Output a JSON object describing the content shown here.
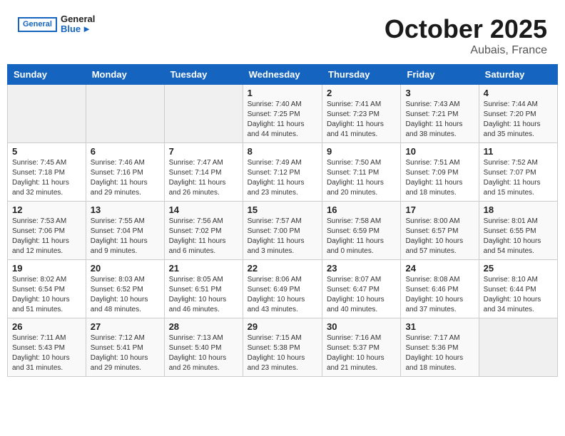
{
  "header": {
    "logo_general": "General",
    "logo_blue": "Blue",
    "month_title": "October 2025",
    "location": "Aubais, France"
  },
  "days_of_week": [
    "Sunday",
    "Monday",
    "Tuesday",
    "Wednesday",
    "Thursday",
    "Friday",
    "Saturday"
  ],
  "weeks": [
    [
      {
        "day": "",
        "info": ""
      },
      {
        "day": "",
        "info": ""
      },
      {
        "day": "",
        "info": ""
      },
      {
        "day": "1",
        "info": "Sunrise: 7:40 AM\nSunset: 7:25 PM\nDaylight: 11 hours and 44 minutes."
      },
      {
        "day": "2",
        "info": "Sunrise: 7:41 AM\nSunset: 7:23 PM\nDaylight: 11 hours and 41 minutes."
      },
      {
        "day": "3",
        "info": "Sunrise: 7:43 AM\nSunset: 7:21 PM\nDaylight: 11 hours and 38 minutes."
      },
      {
        "day": "4",
        "info": "Sunrise: 7:44 AM\nSunset: 7:20 PM\nDaylight: 11 hours and 35 minutes."
      }
    ],
    [
      {
        "day": "5",
        "info": "Sunrise: 7:45 AM\nSunset: 7:18 PM\nDaylight: 11 hours and 32 minutes."
      },
      {
        "day": "6",
        "info": "Sunrise: 7:46 AM\nSunset: 7:16 PM\nDaylight: 11 hours and 29 minutes."
      },
      {
        "day": "7",
        "info": "Sunrise: 7:47 AM\nSunset: 7:14 PM\nDaylight: 11 hours and 26 minutes."
      },
      {
        "day": "8",
        "info": "Sunrise: 7:49 AM\nSunset: 7:12 PM\nDaylight: 11 hours and 23 minutes."
      },
      {
        "day": "9",
        "info": "Sunrise: 7:50 AM\nSunset: 7:11 PM\nDaylight: 11 hours and 20 minutes."
      },
      {
        "day": "10",
        "info": "Sunrise: 7:51 AM\nSunset: 7:09 PM\nDaylight: 11 hours and 18 minutes."
      },
      {
        "day": "11",
        "info": "Sunrise: 7:52 AM\nSunset: 7:07 PM\nDaylight: 11 hours and 15 minutes."
      }
    ],
    [
      {
        "day": "12",
        "info": "Sunrise: 7:53 AM\nSunset: 7:06 PM\nDaylight: 11 hours and 12 minutes."
      },
      {
        "day": "13",
        "info": "Sunrise: 7:55 AM\nSunset: 7:04 PM\nDaylight: 11 hours and 9 minutes."
      },
      {
        "day": "14",
        "info": "Sunrise: 7:56 AM\nSunset: 7:02 PM\nDaylight: 11 hours and 6 minutes."
      },
      {
        "day": "15",
        "info": "Sunrise: 7:57 AM\nSunset: 7:00 PM\nDaylight: 11 hours and 3 minutes."
      },
      {
        "day": "16",
        "info": "Sunrise: 7:58 AM\nSunset: 6:59 PM\nDaylight: 11 hours and 0 minutes."
      },
      {
        "day": "17",
        "info": "Sunrise: 8:00 AM\nSunset: 6:57 PM\nDaylight: 10 hours and 57 minutes."
      },
      {
        "day": "18",
        "info": "Sunrise: 8:01 AM\nSunset: 6:55 PM\nDaylight: 10 hours and 54 minutes."
      }
    ],
    [
      {
        "day": "19",
        "info": "Sunrise: 8:02 AM\nSunset: 6:54 PM\nDaylight: 10 hours and 51 minutes."
      },
      {
        "day": "20",
        "info": "Sunrise: 8:03 AM\nSunset: 6:52 PM\nDaylight: 10 hours and 48 minutes."
      },
      {
        "day": "21",
        "info": "Sunrise: 8:05 AM\nSunset: 6:51 PM\nDaylight: 10 hours and 46 minutes."
      },
      {
        "day": "22",
        "info": "Sunrise: 8:06 AM\nSunset: 6:49 PM\nDaylight: 10 hours and 43 minutes."
      },
      {
        "day": "23",
        "info": "Sunrise: 8:07 AM\nSunset: 6:47 PM\nDaylight: 10 hours and 40 minutes."
      },
      {
        "day": "24",
        "info": "Sunrise: 8:08 AM\nSunset: 6:46 PM\nDaylight: 10 hours and 37 minutes."
      },
      {
        "day": "25",
        "info": "Sunrise: 8:10 AM\nSunset: 6:44 PM\nDaylight: 10 hours and 34 minutes."
      }
    ],
    [
      {
        "day": "26",
        "info": "Sunrise: 7:11 AM\nSunset: 5:43 PM\nDaylight: 10 hours and 31 minutes."
      },
      {
        "day": "27",
        "info": "Sunrise: 7:12 AM\nSunset: 5:41 PM\nDaylight: 10 hours and 29 minutes."
      },
      {
        "day": "28",
        "info": "Sunrise: 7:13 AM\nSunset: 5:40 PM\nDaylight: 10 hours and 26 minutes."
      },
      {
        "day": "29",
        "info": "Sunrise: 7:15 AM\nSunset: 5:38 PM\nDaylight: 10 hours and 23 minutes."
      },
      {
        "day": "30",
        "info": "Sunrise: 7:16 AM\nSunset: 5:37 PM\nDaylight: 10 hours and 21 minutes."
      },
      {
        "day": "31",
        "info": "Sunrise: 7:17 AM\nSunset: 5:36 PM\nDaylight: 10 hours and 18 minutes."
      },
      {
        "day": "",
        "info": ""
      }
    ]
  ]
}
